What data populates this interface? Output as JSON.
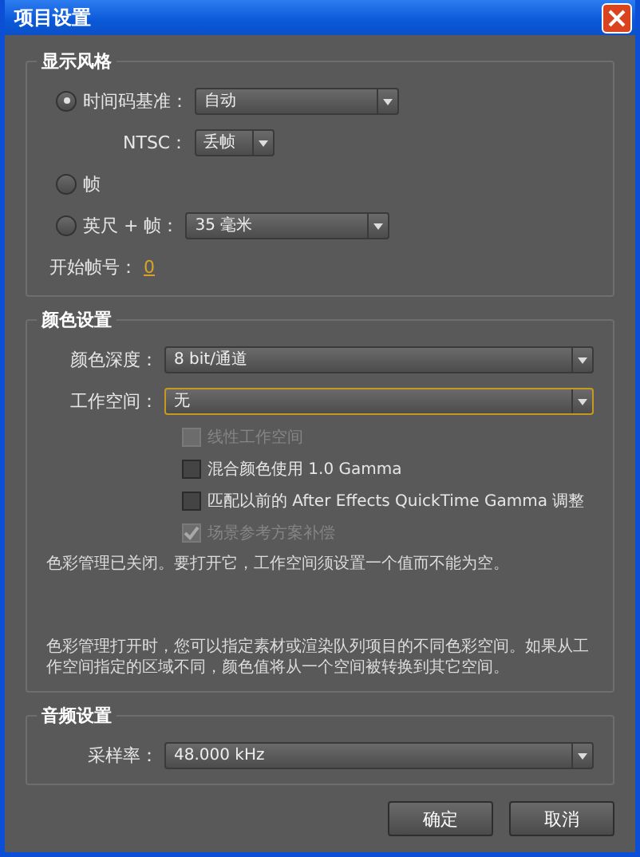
{
  "window": {
    "title": "项目设置"
  },
  "display_style": {
    "title": "显示风格",
    "options": [
      {
        "label": "时间码基准：",
        "selected": true,
        "dropdown": "自动",
        "sub": {
          "label": "NTSC：",
          "dropdown": "丢帧"
        }
      },
      {
        "label": "帧",
        "selected": false
      },
      {
        "label": "英尺 + 帧：",
        "selected": false,
        "dropdown": "35 毫米"
      }
    ],
    "start_frame": {
      "label": "开始帧号：",
      "value": "0"
    }
  },
  "color_settings": {
    "title": "颜色设置",
    "fields": [
      {
        "label": "颜色深度：",
        "value": "8 bit/通道",
        "focused": false
      },
      {
        "label": "工作空间：",
        "value": "无",
        "focused": true
      }
    ],
    "checkboxes": [
      {
        "label": "线性工作空间",
        "checked": false,
        "disabled": true
      },
      {
        "label": "混合颜色使用 1.0 Gamma",
        "checked": false,
        "disabled": false
      },
      {
        "label": "匹配以前的 After Effects QuickTime Gamma 调整",
        "checked": false,
        "disabled": false
      },
      {
        "label": "场景参考方案补偿",
        "checked": true,
        "disabled": true
      }
    ],
    "notes": [
      "色彩管理已关闭。要打开它，工作空间须设置一个值而不能为空。",
      "色彩管理打开时，您可以指定素材或渲染队列项目的不同色彩空间。如果从工作空间指定的区域不同，颜色值将从一个空间被转换到其它空间。"
    ]
  },
  "audio_settings": {
    "title": "音频设置",
    "fields": [
      {
        "label": "采样率：",
        "value": "48.000 kHz"
      }
    ]
  },
  "buttons": [
    {
      "label": "确定"
    },
    {
      "label": "取消"
    }
  ]
}
